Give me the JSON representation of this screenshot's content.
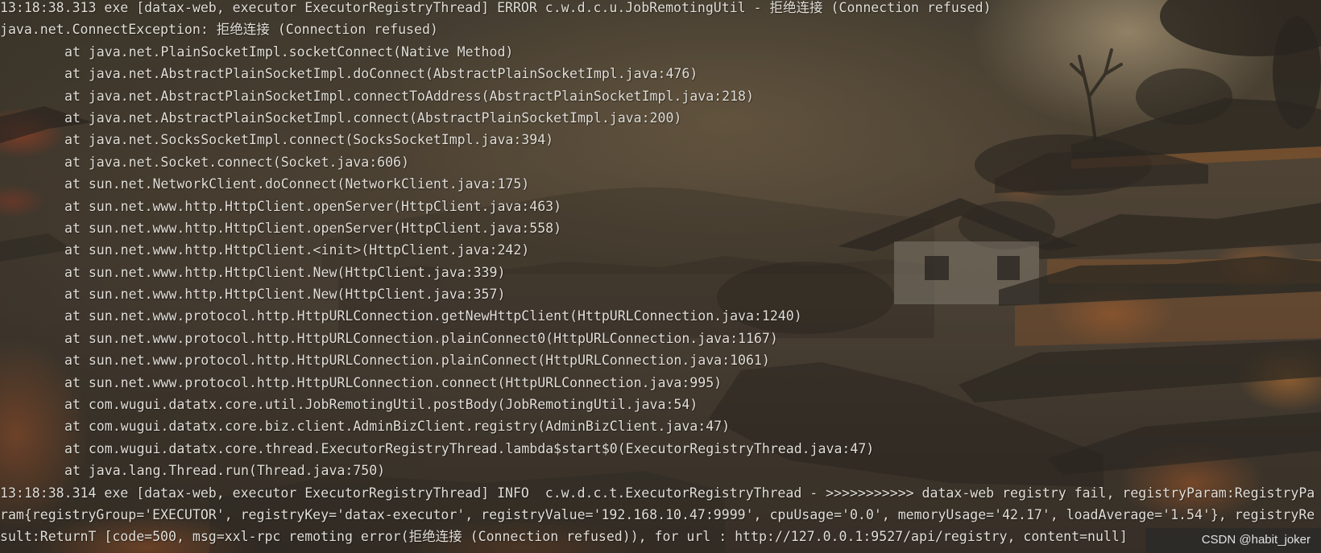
{
  "terminal": {
    "lines": [
      "13:18:38.313 exe [datax-web, executor ExecutorRegistryThread] ERROR c.w.d.c.u.JobRemotingUtil - 拒绝连接 (Connection refused)",
      "java.net.ConnectException: 拒绝连接 (Connection refused)",
      "at java.net.PlainSocketImpl.socketConnect(Native Method)",
      "at java.net.AbstractPlainSocketImpl.doConnect(AbstractPlainSocketImpl.java:476)",
      "at java.net.AbstractPlainSocketImpl.connectToAddress(AbstractPlainSocketImpl.java:218)",
      "at java.net.AbstractPlainSocketImpl.connect(AbstractPlainSocketImpl.java:200)",
      "at java.net.SocksSocketImpl.connect(SocksSocketImpl.java:394)",
      "at java.net.Socket.connect(Socket.java:606)",
      "at sun.net.NetworkClient.doConnect(NetworkClient.java:175)",
      "at sun.net.www.http.HttpClient.openServer(HttpClient.java:463)",
      "at sun.net.www.http.HttpClient.openServer(HttpClient.java:558)",
      "at sun.net.www.http.HttpClient.<init>(HttpClient.java:242)",
      "at sun.net.www.http.HttpClient.New(HttpClient.java:339)",
      "at sun.net.www.http.HttpClient.New(HttpClient.java:357)",
      "at sun.net.www.protocol.http.HttpURLConnection.getNewHttpClient(HttpURLConnection.java:1240)",
      "at sun.net.www.protocol.http.HttpURLConnection.plainConnect0(HttpURLConnection.java:1167)",
      "at sun.net.www.protocol.http.HttpURLConnection.plainConnect(HttpURLConnection.java:1061)",
      "at sun.net.www.protocol.http.HttpURLConnection.connect(HttpURLConnection.java:995)",
      "at com.wugui.datatx.core.util.JobRemotingUtil.postBody(JobRemotingUtil.java:54)",
      "at com.wugui.datatx.core.biz.client.AdminBizClient.registry(AdminBizClient.java:47)",
      "at com.wugui.datatx.core.thread.ExecutorRegistryThread.lambda$start$0(ExecutorRegistryThread.java:47)",
      "at java.lang.Thread.run(Thread.java:750)",
      "13:18:38.314 exe [datax-web, executor ExecutorRegistryThread] INFO  c.w.d.c.t.ExecutorRegistryThread - >>>>>>>>>>> datax-web registry fail, registryParam:RegistryPa",
      "ram{registryGroup='EXECUTOR', registryKey='datax-executor', registryValue='192.168.10.47:9999', cpuUsage='0.0', memoryUsage='42.17', loadAverage='1.54'}, registryRe",
      "sult:ReturnT [code=500, msg=xxl-rpc remoting error(拒绝连接 (Connection refused)), for url : http://127.0.0.1:9527/api/registry, content=null]"
    ]
  },
  "watermark": {
    "text": "CSDN @habit_joker"
  },
  "theme": {
    "text_color": "#e2dfd8",
    "footer_box_color": "#2d2b28"
  }
}
